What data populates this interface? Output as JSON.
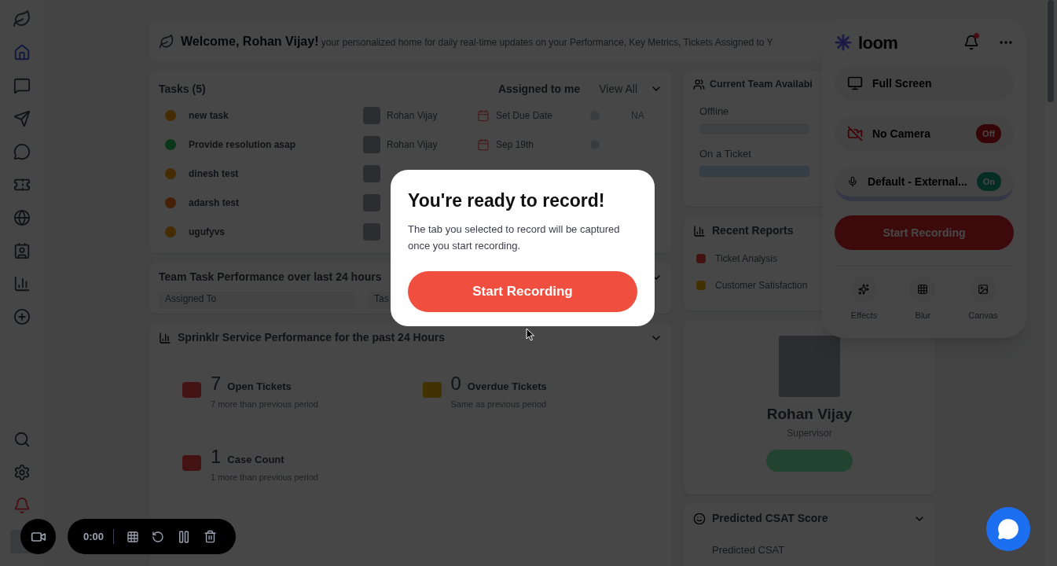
{
  "sidebar": {
    "items": [
      {
        "selected": true
      },
      {
        "selected": false
      },
      {
        "selected": false
      },
      {
        "selected": false
      },
      {
        "selected": false
      },
      {
        "selected": false
      },
      {
        "selected": false
      },
      {
        "selected": false
      },
      {
        "selected": false
      }
    ]
  },
  "welcome": {
    "greeting": "Welcome, Rohan Vijay!",
    "message": "your personalized home for daily real-time updates on your Performance, Key Metrics, Tickets Assigned to Y"
  },
  "tasks": {
    "title": "Tasks (5)",
    "filter": "Assigned to me",
    "view_all": "View All",
    "rows": [
      {
        "name": "new task",
        "color": "#452c03",
        "assignee": "Rohan Vijay",
        "due": "Set Due Date",
        "extra": "NA"
      },
      {
        "name": "Provide resolution asap",
        "color": "#0a371a",
        "assignee": "Rohan Vijay",
        "due": "Sep 19th"
      },
      {
        "name": "dinesh test",
        "color": "#452c03"
      },
      {
        "name": "adarsh test",
        "color": "#462006"
      },
      {
        "name": "ugufyvs",
        "color": "#452c03"
      }
    ]
  },
  "team_task": {
    "title": "Team Task Performance over last 24 hours",
    "filters": [
      "Assigned To",
      "Tas"
    ]
  },
  "service": {
    "title": "Sprinklr Service Performance for the past 24 Hours",
    "metrics": [
      {
        "value": "7",
        "label": "Open Tickets",
        "note": "7 more than previous period",
        "color": "#431313"
      },
      {
        "value": "0",
        "label": "Overdue Tickets",
        "note": "Same as previous period",
        "color": "#423202"
      },
      {
        "value": "1",
        "label": "Case Count",
        "note": "1 more than previous period",
        "color": "#431313"
      }
    ]
  },
  "availability": {
    "title": "Current Team Availabi",
    "statuses": [
      {
        "label": "Offline",
        "color": "#404142"
      },
      {
        "label": "On a Ticket",
        "color": "#353d47"
      }
    ]
  },
  "reports": {
    "title": "Recent Reports",
    "items": [
      {
        "label": "Ticket Analysis",
        "color": "#431313"
      },
      {
        "label": "Customer Satisfaction",
        "color": "#423202"
      }
    ]
  },
  "profile": {
    "name": "Rohan Vijay",
    "role": "Supervisor"
  },
  "csat": {
    "title": "Predicted CSAT Score",
    "subtitle": "Predicted CSAT"
  },
  "modal": {
    "title": "You're ready to record!",
    "body": "The tab you selected to record will be captured once you start recording.",
    "button": "Start Recording"
  },
  "loom": {
    "brand": "loom",
    "notification": true,
    "options": [
      {
        "kind": "screen",
        "label": "Full Screen"
      },
      {
        "kind": "camera",
        "label": "No Camera",
        "toggle": "Off",
        "on": false
      },
      {
        "kind": "mic",
        "label": "Default - External...",
        "toggle": "On",
        "on": true
      }
    ],
    "button": "Start Recording",
    "tools": [
      {
        "kind": "effects",
        "label": "Effects"
      },
      {
        "kind": "blur",
        "label": "Blur"
      },
      {
        "kind": "canvas",
        "label": "Canvas"
      }
    ]
  },
  "recorder": {
    "time": "0:00"
  }
}
